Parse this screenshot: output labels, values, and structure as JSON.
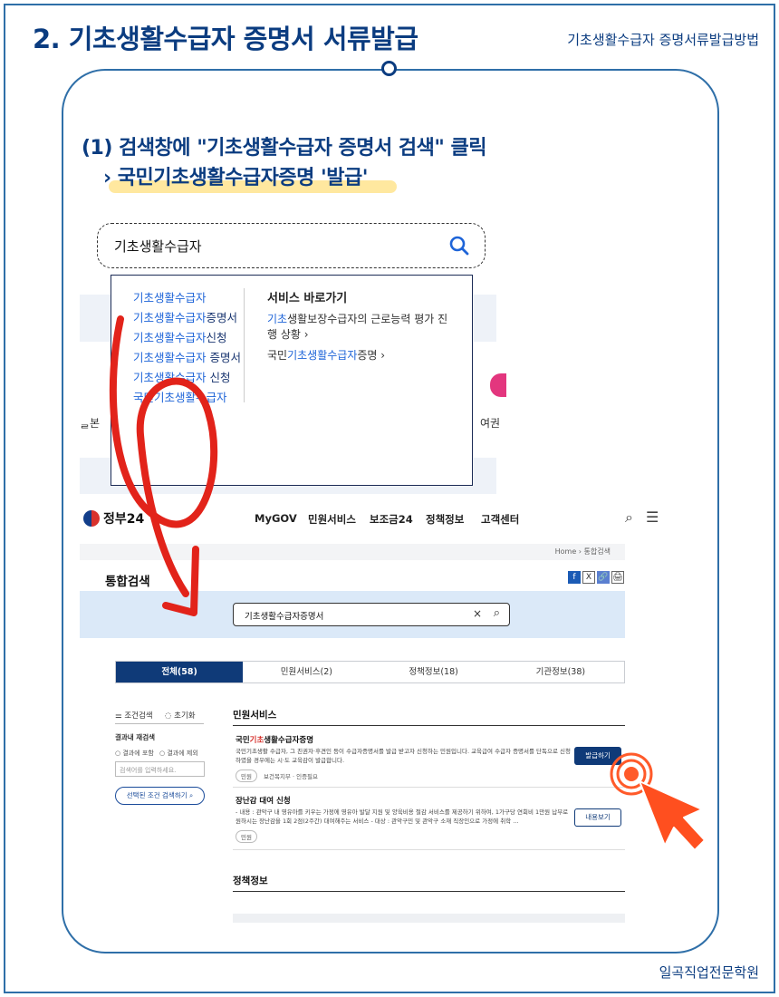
{
  "header": {
    "title": "2. 기초생활수급자 증명서 서류발급",
    "subtitle": "기초생활수급자 증명서류발급방법"
  },
  "step": {
    "line1": "(1)  검색창에 \"기초생활수급자 증명서 검색\" 클릭",
    "line2": "› 국민기초생활수급자증명 '발급'"
  },
  "search_demo": {
    "query": "기초생활수급자",
    "suggestions": [
      {
        "hl": "기초생활수급자",
        "rest": ""
      },
      {
        "hl": "기초생활수급자",
        "rest": "증명서"
      },
      {
        "hl": "기초생활수급자",
        "rest": "신청"
      },
      {
        "hl": "기초생활수급자",
        "rest": " 증명서"
      },
      {
        "hl": "기초생활수급자",
        "rest": " 신청"
      },
      {
        "hl": "국민기초생활수급자",
        "rest": ""
      }
    ],
    "service_title": "서비스 바로가기",
    "service_links": [
      {
        "pre": "",
        "hl": "기초",
        "post": "생활보장수급자의 근로능력 평가 진행 상황",
        "arrow": "›"
      },
      {
        "pre": "국민",
        "hl": "기초생활수급자",
        "post": "증명",
        "arrow": "›"
      }
    ],
    "side_left": "ᆯ본",
    "side_right": "여권"
  },
  "gov_site": {
    "logo": "정부24",
    "nav": [
      "MyGOV",
      "민원서비스",
      "보조금24",
      "정책정보",
      "고객센터"
    ],
    "icons": {
      "search": "search-icon",
      "menu": "menu-icon"
    },
    "breadcrumb": "Home › 통합검색",
    "page_title": "통합검색",
    "share": [
      "f",
      "X",
      "🔗",
      "🖨"
    ],
    "search_value": "기초생활수급자증명서",
    "tabs": [
      "전체(58)",
      "민원서비스(2)",
      "정책정보(18)",
      "기관정보(38)"
    ],
    "filter": {
      "title": "조건검색",
      "reset": "초기화",
      "within_label": "결과내 재검색",
      "opt_include": "결과에 포함",
      "opt_exclude": "결과에 제외",
      "placeholder": "검색어를 입력하세요.",
      "button": "선택된 조건 검색하기"
    },
    "section1": "민원서비스",
    "item1": {
      "title_pre": "국민",
      "title_hl": "기초",
      "title_post": "생활수급자증명",
      "desc": "국민기초생활 수급자, 그 친권자·후견인 등이 수급자증명서를 발급 받고자 신청하는 민원입니다. 교육급여 수급자 증명서를 단독으로 신청하였을 경우에는 시·도 교육감이 발급합니다.",
      "tag": "민원",
      "meta": "보건복지부 · 인증필요",
      "button": "발급하기"
    },
    "item2": {
      "title": "장난감 대여 신청",
      "desc": "- 내용 : 관악구 내 영유아를 키우는 가정에 영유아 발달 지원 및 양육비용 절감 서비스를 제공하기 위하여, 1가구당 연회비 1만원 납부로 원하시는 장난감을 1회 2점(2주간) 대여해주는 서비스 - 대상 : 관악구민 및 관악구 소재 직장인으로 가정에 취학 …",
      "tag": "민원",
      "button": "내용보기"
    },
    "section2": "정책정보"
  },
  "footer": {
    "academy": "일곡직업전문학원"
  },
  "colors": {
    "brand": "#0b3c80",
    "frame": "#2f6fa8",
    "annotation_red": "#e2231a",
    "highlight": "#ffd650"
  }
}
